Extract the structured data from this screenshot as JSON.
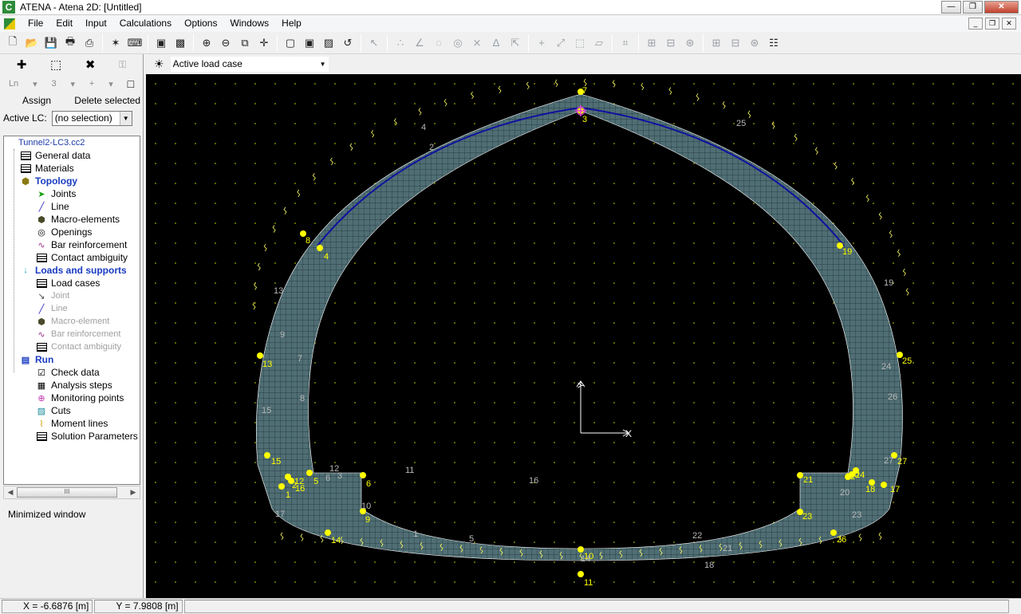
{
  "window": {
    "title": "ATENA - Atena 2D: [Untitled]",
    "app_icon_letter": "C"
  },
  "menu": [
    "File",
    "Edit",
    "Input",
    "Calculations",
    "Options",
    "Windows",
    "Help"
  ],
  "left_panel": {
    "row1_icons": [
      "plus-move-icon",
      "fit-icon",
      "delete-x-icon",
      "lock-icon"
    ],
    "row2": {
      "ln": "Ln",
      "num": "3",
      "plus": "+"
    },
    "assign_label": "Assign",
    "delete_label": "Delete selected",
    "active_lc_label": "Active LC:",
    "active_lc_value": "(no selection)",
    "tree": {
      "root": "Tunnel2-LC3.cc2",
      "items": [
        {
          "label": "General data",
          "level": 1,
          "icon": "grid"
        },
        {
          "label": "Materials",
          "level": 1,
          "icon": "grid"
        },
        {
          "label": "Topology",
          "level": 1,
          "icon": "topology",
          "header": true
        },
        {
          "label": "Joints",
          "level": 2,
          "icon": "arrow"
        },
        {
          "label": "Line",
          "level": 2,
          "icon": "line"
        },
        {
          "label": "Macro-elements",
          "level": 2,
          "icon": "macro"
        },
        {
          "label": "Openings",
          "level": 2,
          "icon": "opening"
        },
        {
          "label": "Bar reinforcement",
          "level": 2,
          "icon": "bar"
        },
        {
          "label": "Contact ambiguity",
          "level": 2,
          "icon": "grid"
        },
        {
          "label": "Loads and supports",
          "level": 1,
          "icon": "load",
          "header": true
        },
        {
          "label": "Load cases",
          "level": 2,
          "icon": "grid"
        },
        {
          "label": "Joint",
          "level": 2,
          "icon": "joint",
          "disabled": true
        },
        {
          "label": "Line",
          "level": 2,
          "icon": "line",
          "disabled": true
        },
        {
          "label": "Macro-element",
          "level": 2,
          "icon": "macro",
          "disabled": true
        },
        {
          "label": "Bar reinforcement",
          "level": 2,
          "icon": "bar",
          "disabled": true
        },
        {
          "label": "Contact ambiguity",
          "level": 2,
          "icon": "grid",
          "disabled": true
        },
        {
          "label": "Run",
          "level": 1,
          "icon": "run",
          "header": true
        },
        {
          "label": "Check data",
          "level": 2,
          "icon": "check"
        },
        {
          "label": "Analysis steps",
          "level": 2,
          "icon": "steps"
        },
        {
          "label": "Monitoring points",
          "level": 2,
          "icon": "monitor"
        },
        {
          "label": "Cuts",
          "level": 2,
          "icon": "cuts"
        },
        {
          "label": "Moment lines",
          "level": 2,
          "icon": "moment"
        },
        {
          "label": "Solution Parameters",
          "level": 2,
          "icon": "grid"
        }
      ]
    },
    "minimized_label": "Minimized window"
  },
  "canvas_toolbar": {
    "load_case": "Active load case"
  },
  "canvas": {
    "background": "#000000",
    "mesh_fill": "#4a6a72",
    "joint_color": "#ffff00",
    "beam_color": "#1010a0",
    "axis_label_x": "X",
    "axis_label_y": "Y",
    "joint_labels": [
      "1",
      "2",
      "3",
      "4",
      "5",
      "6",
      "7",
      "8",
      "9",
      "10",
      "11",
      "12",
      "13",
      "14",
      "15",
      "16",
      "17",
      "18",
      "19",
      "20",
      "21",
      "22",
      "23",
      "24",
      "25",
      "26",
      "27"
    ],
    "line_labels": [
      "1",
      "2",
      "3",
      "4",
      "5",
      "6",
      "7",
      "8",
      "9",
      "10",
      "11",
      "12",
      "13",
      "14",
      "15",
      "16",
      "17",
      "18",
      "19",
      "20",
      "21",
      "22",
      "23",
      "24",
      "25",
      "26",
      "27"
    ]
  },
  "status": {
    "x": "X = -6.6876 [m]",
    "y": "Y = 7.9808 [m]"
  }
}
